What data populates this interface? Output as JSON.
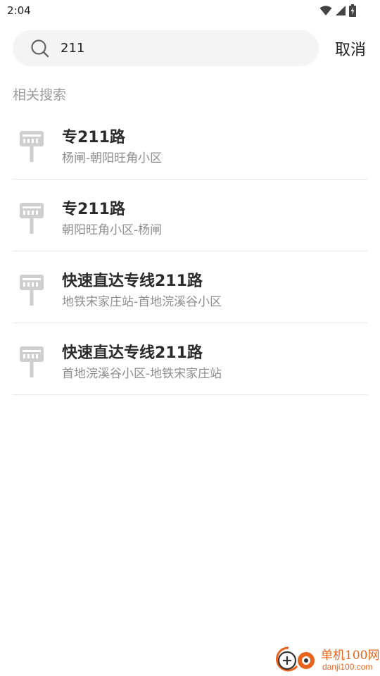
{
  "status_bar": {
    "time": "2:04",
    "icons": [
      "wifi-icon",
      "cell-signal-icon",
      "battery-charging-icon"
    ]
  },
  "search": {
    "query": "211",
    "placeholder": "",
    "cancel_label": "取消"
  },
  "section_title": "相关搜索",
  "results": [
    {
      "name": "专211路",
      "route": "杨闸-朝阳旺角小区",
      "icon": "bus-stop-icon"
    },
    {
      "name": "专211路",
      "route": "朝阳旺角小区-杨闸",
      "icon": "bus-stop-icon"
    },
    {
      "name": "快速直达专线211路",
      "route": "地铁宋家庄站-首地浣溪谷小区",
      "icon": "bus-stop-icon"
    },
    {
      "name": "快速直达专线211路",
      "route": "首地浣溪谷小区-地铁宋家庄站",
      "icon": "bus-stop-icon"
    }
  ],
  "watermark": {
    "name": "单机100网",
    "domain": "danji100.com"
  },
  "colors": {
    "text_primary": "#2b2b2b",
    "text_secondary": "#8e8e8e",
    "search_bg": "#f4f4f4",
    "divider": "#e8e8e8",
    "icon_gray": "#cfcfcf",
    "watermark_orange": "#e8641b"
  }
}
